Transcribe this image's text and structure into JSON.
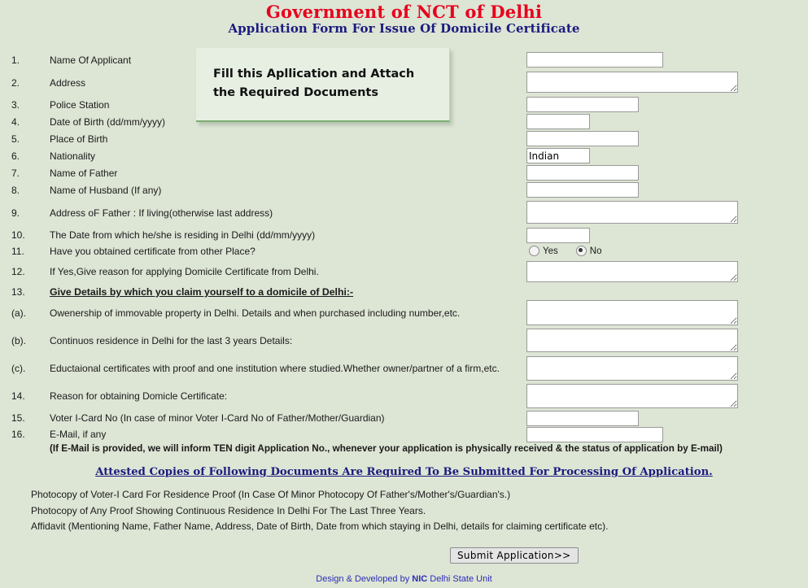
{
  "header": {
    "title": "Government of NCT of Delhi",
    "subtitle": "Application Form For Issue Of Domicile Certificate",
    "title_color": "#e8001c",
    "subtitle_color": "#1b1b7e"
  },
  "callout": {
    "line1": "Fill this Apllication and Attach",
    "line2": "the Required Documents",
    "background": "#e6efe2",
    "accent": "#7bac72"
  },
  "page": {
    "background": "#dde5d5"
  },
  "form": {
    "rows": [
      {
        "num": "1.",
        "label": "Name Of Applicant"
      },
      {
        "num": "2.",
        "label": "Address"
      },
      {
        "num": "3.",
        "label": "Police Station"
      },
      {
        "num": "4.",
        "label": "Date of Birth (dd/mm/yyyy)"
      },
      {
        "num": "5.",
        "label": "Place of Birth"
      },
      {
        "num": "6.",
        "label": "Nationality"
      },
      {
        "num": "7.",
        "label": "Name of Father"
      },
      {
        "num": "8.",
        "label": "Name of Husband (If any)"
      },
      {
        "num": "9.",
        "label": "Address oF Father : If living(otherwise last address)"
      },
      {
        "num": "10.",
        "label": "The Date from which he/she is residing in Delhi (dd/mm/yyyy)"
      },
      {
        "num": "11.",
        "label": "Have you obtained certificate from other Place?"
      },
      {
        "num": "12.",
        "label": "If Yes,Give reason for applying Domicile Certificate from Delhi."
      },
      {
        "num": "13.",
        "label": "Give Details by which you claim yourself to a domicile of Delhi:-"
      },
      {
        "num": "(a).",
        "label": "Owenership of immovable property in Delhi. Details and when purchased including number,etc."
      },
      {
        "num": "(b).",
        "label": "Continuos residence in Delhi for the last 3 years Details:"
      },
      {
        "num": "(c).",
        "label": "Eductaional certificates with proof and one institution where studied.Whether owner/partner of a firm,etc."
      },
      {
        "num": "14.",
        "label": "Reason for obtaining Domicle Certificate:"
      },
      {
        "num": "15.",
        "label": "Voter I-Card No (In case of minor Voter I-Card No of Father/Mother/Guardian)"
      },
      {
        "num": "16.",
        "label": "E-Mail, if any"
      }
    ],
    "values": {
      "name_of_applicant": "",
      "address": "",
      "police_station": "",
      "date_of_birth": "",
      "place_of_birth": "",
      "nationality": "Indian",
      "name_of_father": "",
      "name_of_husband": "",
      "address_of_father": "",
      "date_residing_in_delhi": "",
      "reason_other_place": "",
      "ownership_details": "",
      "continuous_residence": "",
      "educational_certificates": "",
      "reason_for_domicile": "",
      "voter_icard_no": "",
      "email": ""
    },
    "obtained_certificate": {
      "yes_label": "Yes",
      "no_label": "No",
      "selected": "No"
    }
  },
  "notes": {
    "email_note": "(If E-Mail is provided, we will inform TEN digit Application No., whenever your application is physically received & the status of application by E-mail)",
    "attested_heading": "Attested Copies of Following Documents Are Required To Be Submitted For Processing Of Application.",
    "documents": [
      "Photocopy of Voter-I Card For Residence Proof (In Case Of Minor Photocopy Of Father's/Mother's/Guardian's.)",
      "Photocopy of Any Proof Showing Continuous Residence In Delhi For The Last Three Years.",
      "Affidavit (Mentioning Name, Father Name, Address, Date of Birth, Date from which staying in Delhi, details for claiming certificate etc)."
    ]
  },
  "actions": {
    "submit_label": "Submit Application>>"
  },
  "footer": {
    "prefix": "Design & Developed by ",
    "org": "NIC",
    "suffix": " Delhi State Unit"
  }
}
